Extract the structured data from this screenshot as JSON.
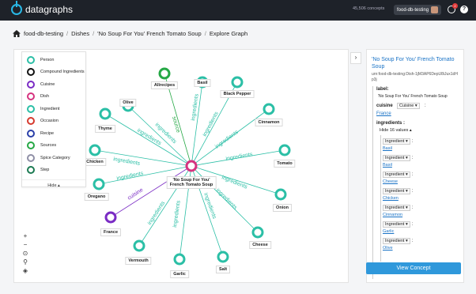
{
  "header": {
    "logo_text": "datagraphs",
    "concepts": "45,506 concepts",
    "project": "food-db-testing",
    "notif_count": "2",
    "help_label": "?"
  },
  "breadcrumb": {
    "items": [
      "food-db-testing",
      "Dishes",
      "'No Soup For You' French Tomato Soup",
      "Explore Graph"
    ],
    "sep": "/"
  },
  "legend": {
    "items": [
      {
        "label": "Person",
        "color": "#2bbfa6"
      },
      {
        "label": "Compound Ingredients",
        "color": "#111111"
      },
      {
        "label": "Cuisine",
        "color": "#7a2bc4"
      },
      {
        "label": "Dish",
        "color": "#d6337f"
      },
      {
        "label": "Ingredient",
        "color": "#2bbfa6"
      },
      {
        "label": "Occasion",
        "color": "#d63a2e"
      },
      {
        "label": "Recipe",
        "color": "#2a3fa8"
      },
      {
        "label": "Sources",
        "color": "#25a845"
      },
      {
        "label": "Spice Category",
        "color": "#8f8fa6"
      },
      {
        "label": "Step",
        "color": "#1b7a52"
      }
    ],
    "hide_label": "Hide ▴"
  },
  "zoom": {
    "plus": "+",
    "minus": "−",
    "fit": "⊙",
    "pin": "⚲",
    "layers": "◈"
  },
  "graph": {
    "center_label_1": "'No Soup For You'",
    "center_label_2": "French Tomato Soup",
    "edge_ingredients": "ingredients",
    "edge_source": "source",
    "edge_cuisine": "cuisine",
    "nodes": {
      "allrecipes": "Allrecipes",
      "basil": "Basil",
      "black_pepper": "Black Pepper",
      "olive": "Olive",
      "cinnamon": "Cinnamon",
      "thyme": "Thyme",
      "chicken": "Chicken",
      "tomato": "Tomato",
      "oregano": "Oregano",
      "onion": "Onion",
      "france": "France",
      "cheese": "Cheese",
      "vermouth": "Vermouth",
      "salt": "Salt",
      "garlic": "Garlic"
    },
    "collapse_icon": "›"
  },
  "panel": {
    "title": "'No Soup For You' French Tomato Soup",
    "urn": "urn:food-db-testing:Dish-1jM3AP6DepU8iJux1dHp3j",
    "label_key": "label:",
    "label_value": "'No Soup For You' French Tomato Soup",
    "cuisine_key": "cuisine",
    "cuisine_select": "Cuisine ▾",
    "colon": ":",
    "cuisine_value": "France",
    "ingredients_key": "ingredients :",
    "hide_values": "Hide 16 values ▴",
    "ingredient_select": "Ingredient ▾",
    "ingredients": [
      "Basil",
      "Basil",
      "Cheese",
      "Chicken",
      "Cinnamon",
      "Garlic",
      "Olive"
    ],
    "view_button": "View Concept"
  }
}
